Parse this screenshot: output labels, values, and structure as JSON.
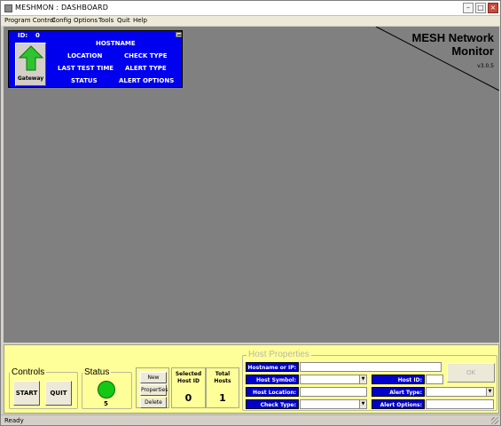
{
  "window": {
    "title": "MESHMON : DASHBOARD",
    "min": "–",
    "max": "□",
    "close": "×"
  },
  "menu": [
    "Program Control",
    "Config",
    "Options",
    "Tools",
    "Quit",
    "Help"
  ],
  "brand": {
    "title_line1": "MESH Network",
    "title_line2": "Monitor",
    "version": "v3.0.5"
  },
  "host_card": {
    "id_label": "ID:",
    "id_value": "0",
    "hostname": "HOSTNAME",
    "location": "LOCATION",
    "check_type": "CHECK TYPE",
    "last_test_time": "LAST TEST TIME",
    "alert_type": "ALERT TYPE",
    "status": "STATUS",
    "alert_options": "ALERT OPTIONS",
    "icon_label": "Gateway"
  },
  "controls": {
    "legend": "Controls",
    "start": "START",
    "quit": "QUIT"
  },
  "status": {
    "legend": "Status",
    "value": "5"
  },
  "host_buttons": {
    "new_host": "New Host",
    "properties": "Properties",
    "delete": "Delete"
  },
  "selected_host": {
    "label": "Selected Host ID",
    "value": "0"
  },
  "total_hosts": {
    "label": "Total Hosts",
    "value": "1"
  },
  "host_properties": {
    "legend": "Host Properties",
    "hostname_ip": "Hostname or IP:",
    "host_symbol": "Host Symbol:",
    "host_location": "Host Location:",
    "check_type": "Check Type:",
    "host_id": "Host ID:",
    "alert_type": "Alert Type:",
    "alert_options": "Alert Options:",
    "ok": "OK"
  },
  "statusbar": {
    "text": "Ready"
  },
  "colors": {
    "card_blue": "#0000ee",
    "panel_yellow": "#ffff99",
    "lamp_green": "#14c814",
    "canvas_gray": "#808080"
  }
}
